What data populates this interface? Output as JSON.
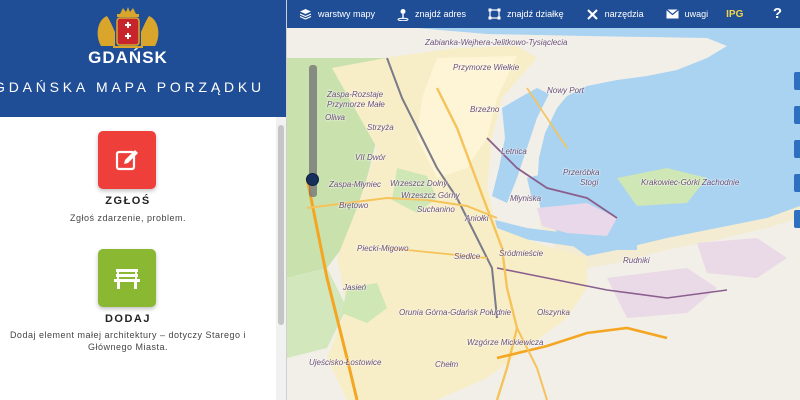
{
  "sidebar": {
    "city_name": "GDAŃSK",
    "subtitle": "GDAŃSKA MAPA PORZĄDKU",
    "actions": [
      {
        "label": "ZGŁOŚ",
        "description": "Zgłoś zdarzenie, problem.",
        "icon": "edit-icon",
        "color": "#ee3f3a"
      },
      {
        "label": "DODAJ",
        "description_line1": "Dodaj element małej architektury – dotyczy Starego i",
        "description_line2": "Głównego Miasta.",
        "icon": "bench-icon",
        "color": "#8ab833"
      }
    ]
  },
  "toolbar": {
    "layers_label": "warstwy mapy",
    "find_address_label": "znajdź adres",
    "find_plot_label": "znajdź działkę",
    "tools_label": "narzędzia",
    "notes_label": "uwagi",
    "ipg_label": "IPG",
    "help_label": "?"
  },
  "map": {
    "places": [
      "Zaspa-Rozstaje",
      "Przymorze Małe",
      "Oliwa",
      "Strzyża",
      "VII Dwór",
      "Zaspa-Młyniec",
      "Wrzeszcz Dolny",
      "Wrzeszcz Górny",
      "Brętowo",
      "Suchanino",
      "Aniołki",
      "Młyniska",
      "Piecki-Migowo",
      "Siedlce",
      "Śródmieście",
      "Jasień",
      "Orunia Górna-Gdańsk Południe",
      "Ujeścisko-Łostowice",
      "Chełm",
      "Wzgórze Mickiewicza",
      "Olszynka",
      "Rudniki",
      "Przeróbka",
      "Stogi",
      "Krakowiec-Górki Zachodnie",
      "Letnica",
      "Brzeźno",
      "Nowy Port",
      "Przymorze Wielkie",
      "Zabianka-Wejhera-Jelitkowo-Tysiąclecia"
    ]
  },
  "colors": {
    "brand_blue": "#1f4e96",
    "sea": "#a9d3f0",
    "ipg_yellow": "#f3d54c"
  }
}
